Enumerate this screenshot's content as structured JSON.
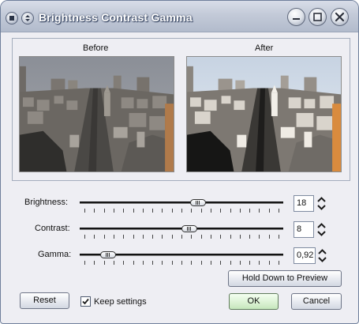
{
  "window": {
    "title": "Brightness Contrast Gamma"
  },
  "preview": {
    "before_label": "Before",
    "after_label": "After"
  },
  "sliders": [
    {
      "label": "Brightness:",
      "value_text": "18",
      "position_fraction": 0.59
    },
    {
      "label": "Contrast:",
      "value_text": "8",
      "position_fraction": 0.54
    },
    {
      "label": "Gamma:",
      "value_text": "0,92",
      "position_fraction": 0.11
    }
  ],
  "buttons": {
    "hold_preview": "Hold Down to Preview",
    "reset": "Reset",
    "ok": "OK",
    "cancel": "Cancel"
  },
  "keep_settings": {
    "label": "Keep settings",
    "checked": true
  },
  "colors": {
    "ok_button": "#daf1d2",
    "title_text": "#ffffff"
  }
}
